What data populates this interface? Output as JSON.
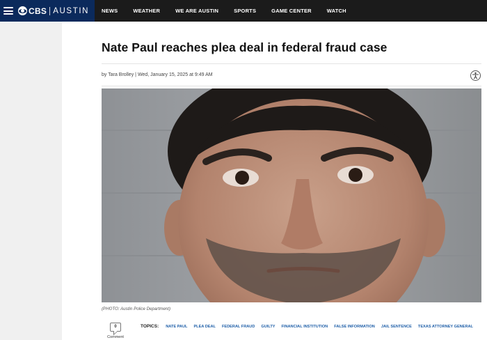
{
  "header": {
    "logo": {
      "network": "CBS",
      "city": "AUSTIN"
    },
    "nav": [
      {
        "label": "NEWS"
      },
      {
        "label": "WEATHER"
      },
      {
        "label": "WE ARE AUSTIN"
      },
      {
        "label": "SPORTS"
      },
      {
        "label": "GAME CENTER"
      },
      {
        "label": "WATCH"
      }
    ]
  },
  "article": {
    "headline": "Nate Paul reaches plea deal in federal fraud case",
    "byline": {
      "prefix": "by",
      "author": "Tara Brolley",
      "separator": "|",
      "datetime": "Wed, January 15, 2025 at 9:49 AM"
    },
    "photo_caption": "(PHOTO: Austin Police Department)"
  },
  "comments": {
    "count": "0",
    "label": "Comment"
  },
  "topics": {
    "label": "TOPICS:",
    "items": [
      "NATE PAUL",
      "PLEA DEAL",
      "FEDERAL FRAUD",
      "GUILTY",
      "FINANCIAL INSTITUTION",
      "FALSE INFORMATION",
      "JAIL SENTENCE",
      "TEXAS ATTORNEY GENERAL"
    ]
  },
  "colors": {
    "brand_navy": "#0b2a5c",
    "topbar": "#1b1b1b",
    "topic_link": "#1f5fa8"
  },
  "icons": [
    "hamburger-menu-icon",
    "cbs-eye-icon",
    "accessibility-icon",
    "comment-icon"
  ]
}
